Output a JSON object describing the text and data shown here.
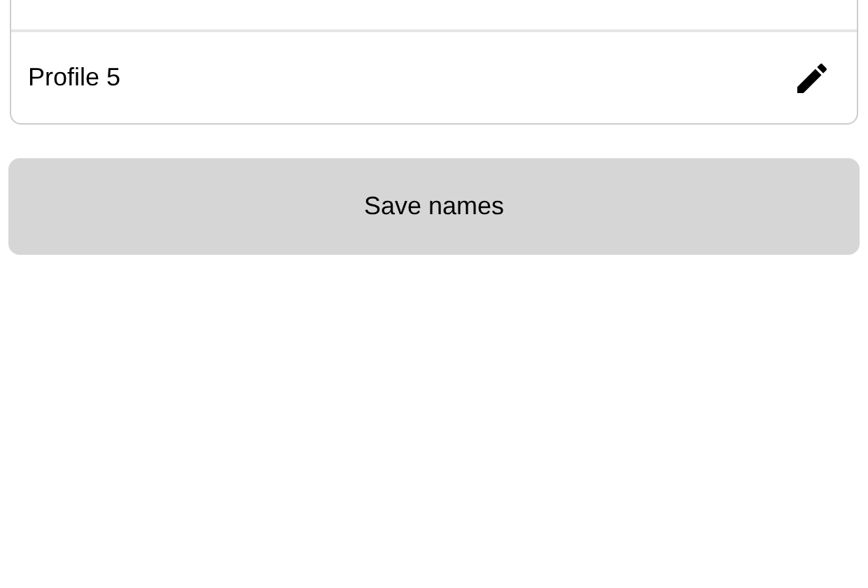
{
  "profiles": [
    {
      "name": "Profile 5"
    }
  ],
  "save_button": {
    "label": "Save names"
  }
}
